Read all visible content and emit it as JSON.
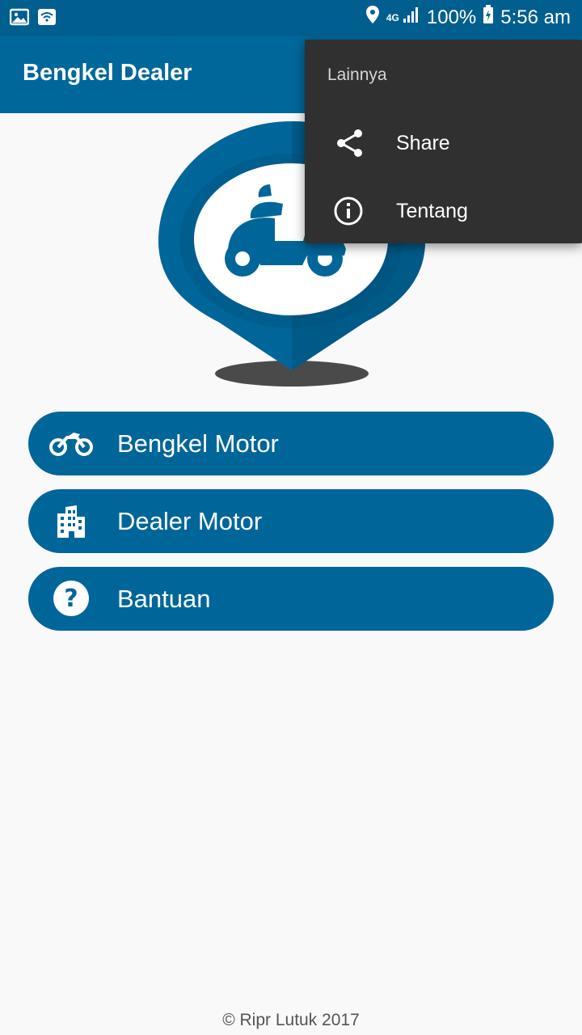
{
  "status_bar": {
    "battery": "100%",
    "time": "5:56 am",
    "network": "4G"
  },
  "app_bar": {
    "title": "Bengkel Dealer"
  },
  "menu": [
    {
      "label": "Bengkel Motor",
      "icon": "motorcycle-icon"
    },
    {
      "label": "Dealer Motor",
      "icon": "building-icon"
    },
    {
      "label": "Bantuan",
      "icon": "help-icon"
    }
  ],
  "overflow_menu": {
    "header": "Lainnya",
    "items": [
      {
        "label": "Share",
        "icon": "share-icon"
      },
      {
        "label": "Tentang",
        "icon": "info-icon"
      }
    ]
  },
  "footer": {
    "copyright": "© Ripr Lutuk 2017"
  },
  "colors": {
    "primary": "#00679a",
    "status_bar": "#005f8e",
    "popup_bg": "#303030",
    "background": "#f9f9f9"
  }
}
